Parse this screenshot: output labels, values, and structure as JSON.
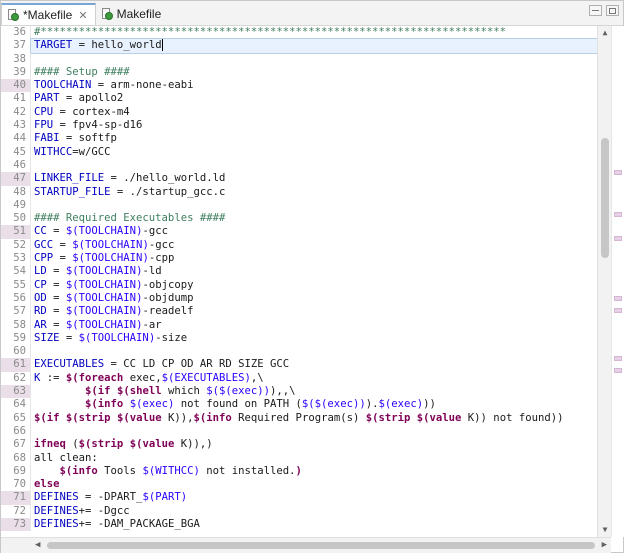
{
  "tabs": [
    {
      "label": "*Makefile",
      "close": "✕",
      "active": true
    },
    {
      "label": "Makefile",
      "active": false
    }
  ],
  "colors": {
    "comment": "#3f7f5f",
    "keyword": "#7f0055",
    "variable": "#0000c0",
    "reference": "#2a00ff",
    "marker": "#eadfe8",
    "current_line": "#e8f2fe"
  },
  "editor": {
    "current_line_number": "37",
    "lines": [
      {
        "n": "36",
        "tokens": [
          {
            "t": "#*************************************************************************",
            "c": "cmt"
          }
        ]
      },
      {
        "n": "37",
        "current": true,
        "tokens": [
          {
            "t": "TARGET",
            "c": "var"
          },
          {
            "t": " = hello_world",
            "c": "plain"
          }
        ]
      },
      {
        "n": "38",
        "tokens": []
      },
      {
        "n": "39",
        "tokens": [
          {
            "t": "#### Setup ####",
            "c": "cmt"
          }
        ]
      },
      {
        "n": "40",
        "mark": true,
        "tokens": [
          {
            "t": "TOOLCHAIN",
            "c": "var"
          },
          {
            "t": " = arm-none-eabi",
            "c": "plain"
          }
        ]
      },
      {
        "n": "41",
        "tokens": [
          {
            "t": "PART",
            "c": "var"
          },
          {
            "t": " = apollo2",
            "c": "plain"
          }
        ]
      },
      {
        "n": "42",
        "tokens": [
          {
            "t": "CPU",
            "c": "var"
          },
          {
            "t": " = cortex-m4",
            "c": "plain"
          }
        ]
      },
      {
        "n": "43",
        "tokens": [
          {
            "t": "FPU",
            "c": "var"
          },
          {
            "t": " = fpv4-sp-d16",
            "c": "plain"
          }
        ]
      },
      {
        "n": "44",
        "tokens": [
          {
            "t": "FABI",
            "c": "var"
          },
          {
            "t": " = softfp",
            "c": "plain"
          }
        ]
      },
      {
        "n": "45",
        "tokens": [
          {
            "t": "WITHCC",
            "c": "var"
          },
          {
            "t": "=w/GCC",
            "c": "plain"
          }
        ]
      },
      {
        "n": "46",
        "tokens": []
      },
      {
        "n": "47",
        "mark": true,
        "tokens": [
          {
            "t": "LINKER_FILE",
            "c": "var"
          },
          {
            "t": " = ./hello_world.ld",
            "c": "plain"
          }
        ]
      },
      {
        "n": "48",
        "tokens": [
          {
            "t": "STARTUP_FILE",
            "c": "var"
          },
          {
            "t": " = ./startup_gcc.c",
            "c": "plain"
          }
        ]
      },
      {
        "n": "49",
        "tokens": []
      },
      {
        "n": "50",
        "tokens": [
          {
            "t": "#### Required Executables ####",
            "c": "cmt"
          }
        ]
      },
      {
        "n": "51",
        "mark": true,
        "tokens": [
          {
            "t": "CC",
            "c": "var"
          },
          {
            "t": " = ",
            "c": "plain"
          },
          {
            "t": "$(TOOLCHAIN)",
            "c": "vref"
          },
          {
            "t": "-gcc",
            "c": "plain"
          }
        ]
      },
      {
        "n": "52",
        "tokens": [
          {
            "t": "GCC",
            "c": "var"
          },
          {
            "t": " = ",
            "c": "plain"
          },
          {
            "t": "$(TOOLCHAIN)",
            "c": "vref"
          },
          {
            "t": "-gcc",
            "c": "plain"
          }
        ]
      },
      {
        "n": "53",
        "tokens": [
          {
            "t": "CPP",
            "c": "var"
          },
          {
            "t": " = ",
            "c": "plain"
          },
          {
            "t": "$(TOOLCHAIN)",
            "c": "vref"
          },
          {
            "t": "-cpp",
            "c": "plain"
          }
        ]
      },
      {
        "n": "54",
        "tokens": [
          {
            "t": "LD",
            "c": "var"
          },
          {
            "t": " = ",
            "c": "plain"
          },
          {
            "t": "$(TOOLCHAIN)",
            "c": "vref"
          },
          {
            "t": "-ld",
            "c": "plain"
          }
        ]
      },
      {
        "n": "55",
        "tokens": [
          {
            "t": "CP",
            "c": "var"
          },
          {
            "t": " = ",
            "c": "plain"
          },
          {
            "t": "$(TOOLCHAIN)",
            "c": "vref"
          },
          {
            "t": "-objcopy",
            "c": "plain"
          }
        ]
      },
      {
        "n": "56",
        "tokens": [
          {
            "t": "OD",
            "c": "var"
          },
          {
            "t": " = ",
            "c": "plain"
          },
          {
            "t": "$(TOOLCHAIN)",
            "c": "vref"
          },
          {
            "t": "-objdump",
            "c": "plain"
          }
        ]
      },
      {
        "n": "57",
        "tokens": [
          {
            "t": "RD",
            "c": "var"
          },
          {
            "t": " = ",
            "c": "plain"
          },
          {
            "t": "$(TOOLCHAIN)",
            "c": "vref"
          },
          {
            "t": "-readelf",
            "c": "plain"
          }
        ]
      },
      {
        "n": "58",
        "tokens": [
          {
            "t": "AR",
            "c": "var"
          },
          {
            "t": " = ",
            "c": "plain"
          },
          {
            "t": "$(TOOLCHAIN)",
            "c": "vref"
          },
          {
            "t": "-ar",
            "c": "plain"
          }
        ]
      },
      {
        "n": "59",
        "tokens": [
          {
            "t": "SIZE",
            "c": "var"
          },
          {
            "t": " = ",
            "c": "plain"
          },
          {
            "t": "$(TOOLCHAIN)",
            "c": "vref"
          },
          {
            "t": "-size",
            "c": "plain"
          }
        ]
      },
      {
        "n": "60",
        "tokens": []
      },
      {
        "n": "61",
        "mark": true,
        "tokens": [
          {
            "t": "EXECUTABLES",
            "c": "var"
          },
          {
            "t": " = CC LD CP OD AR RD SIZE GCC",
            "c": "plain"
          }
        ]
      },
      {
        "n": "62",
        "tokens": [
          {
            "t": "K",
            "c": "var"
          },
          {
            "t": " := ",
            "c": "plain"
          },
          {
            "t": "$(foreach",
            "c": "kw"
          },
          {
            "t": " exec,",
            "c": "plain"
          },
          {
            "t": "$(EXECUTABLES)",
            "c": "vref"
          },
          {
            "t": ",\\",
            "c": "plain"
          }
        ]
      },
      {
        "n": "63",
        "mark": true,
        "tokens": [
          {
            "t": "        ",
            "c": "plain"
          },
          {
            "t": "$(if",
            "c": "kw"
          },
          {
            "t": " ",
            "c": "plain"
          },
          {
            "t": "$(shell",
            "c": "kw"
          },
          {
            "t": " which ",
            "c": "plain"
          },
          {
            "t": "$($(exec))",
            "c": "vref"
          },
          {
            "t": "),,\\",
            "c": "plain"
          }
        ]
      },
      {
        "n": "64",
        "tokens": [
          {
            "t": "        ",
            "c": "plain"
          },
          {
            "t": "$(info",
            "c": "kw"
          },
          {
            "t": " ",
            "c": "plain"
          },
          {
            "t": "$(exec)",
            "c": "vref"
          },
          {
            "t": " not found on PATH (",
            "c": "plain"
          },
          {
            "t": "$($(exec))",
            "c": "vref"
          },
          {
            "t": ").",
            "c": "plain"
          },
          {
            "t": "$(exec)",
            "c": "vref"
          },
          {
            "t": "))",
            "c": "plain"
          }
        ]
      },
      {
        "n": "65",
        "tokens": [
          {
            "t": "$(if",
            "c": "kw"
          },
          {
            "t": " ",
            "c": "plain"
          },
          {
            "t": "$(strip",
            "c": "kw"
          },
          {
            "t": " ",
            "c": "plain"
          },
          {
            "t": "$(value",
            "c": "kw"
          },
          {
            "t": " K)),",
            "c": "plain"
          },
          {
            "t": "$(info",
            "c": "kw"
          },
          {
            "t": " Required Program(s) ",
            "c": "plain"
          },
          {
            "t": "$(strip",
            "c": "kw"
          },
          {
            "t": " ",
            "c": "plain"
          },
          {
            "t": "$(value",
            "c": "kw"
          },
          {
            "t": " K)) not found))",
            "c": "plain"
          }
        ]
      },
      {
        "n": "66",
        "tokens": []
      },
      {
        "n": "67",
        "tokens": [
          {
            "t": "ifneq",
            "c": "kw"
          },
          {
            "t": " (",
            "c": "plain"
          },
          {
            "t": "$(strip",
            "c": "kw"
          },
          {
            "t": " ",
            "c": "plain"
          },
          {
            "t": "$(value",
            "c": "kw"
          },
          {
            "t": " K)),)",
            "c": "plain"
          }
        ]
      },
      {
        "n": "68",
        "tokens": [
          {
            "t": "all clean:",
            "c": "plain"
          }
        ]
      },
      {
        "n": "69",
        "tokens": [
          {
            "t": "    ",
            "c": "plain"
          },
          {
            "t": "$(info",
            "c": "kw"
          },
          {
            "t": " Tools ",
            "c": "plain"
          },
          {
            "t": "$(WITHCC)",
            "c": "vref"
          },
          {
            "t": " not installed.",
            "c": "plain"
          },
          {
            "t": ")",
            "c": "kw"
          }
        ]
      },
      {
        "n": "70",
        "tokens": [
          {
            "t": "else",
            "c": "kw"
          }
        ]
      },
      {
        "n": "71",
        "mark": true,
        "tokens": [
          {
            "t": "DEFINES",
            "c": "var"
          },
          {
            "t": " = -DPART_",
            "c": "plain"
          },
          {
            "t": "$(PART)",
            "c": "vref"
          }
        ]
      },
      {
        "n": "72",
        "tokens": [
          {
            "t": "DEFINES",
            "c": "var"
          },
          {
            "t": "+= -Dgcc",
            "c": "plain"
          }
        ]
      },
      {
        "n": "73",
        "mark": true,
        "tokens": [
          {
            "t": "DEFINES",
            "c": "var"
          },
          {
            "t": "+= -DAM_PACKAGE_BGA",
            "c": "plain"
          }
        ]
      }
    ]
  },
  "scroll_arrows": {
    "up": "▲",
    "down": "▼",
    "left": "◀",
    "right": "▶"
  }
}
